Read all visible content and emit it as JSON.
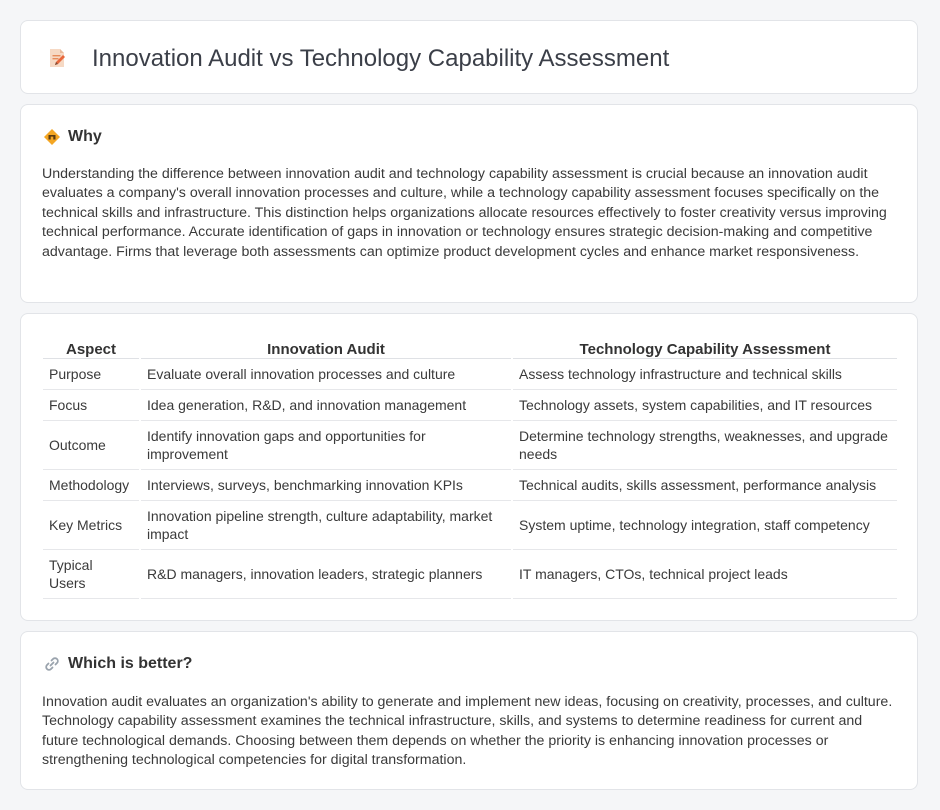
{
  "title": "Innovation Audit vs Technology Capability Assessment",
  "icons": {
    "title": "document-pen-icon",
    "why": "signpost-icon",
    "better": "link-icon"
  },
  "why": {
    "heading": "Why",
    "text": "Understanding the difference between innovation audit and technology capability assessment is crucial because an innovation audit evaluates a company's overall innovation processes and culture, while a technology capability assessment focuses specifically on the technical skills and infrastructure. This distinction helps organizations allocate resources effectively to foster creativity versus improving technical performance. Accurate identification of gaps in innovation or technology ensures strategic decision-making and competitive advantage. Firms that leverage both assessments can optimize product development cycles and enhance market responsiveness."
  },
  "table": {
    "headers": [
      "Aspect",
      "Innovation Audit",
      "Technology Capability Assessment"
    ],
    "rows": [
      [
        "Purpose",
        "Evaluate overall innovation processes and culture",
        "Assess technology infrastructure and technical skills"
      ],
      [
        "Focus",
        "Idea generation, R&D, and innovation management",
        "Technology assets, system capabilities, and IT resources"
      ],
      [
        "Outcome",
        "Identify innovation gaps and opportunities for improvement",
        "Determine technology strengths, weaknesses, and upgrade needs"
      ],
      [
        "Methodology",
        "Interviews, surveys, benchmarking innovation KPIs",
        "Technical audits, skills assessment, performance analysis"
      ],
      [
        "Key Metrics",
        "Innovation pipeline strength, culture adaptability, market impact",
        "System uptime, technology integration, staff competency"
      ],
      [
        "Typical Users",
        "R&D managers, innovation leaders, strategic planners",
        "IT managers, CTOs, technical project leads"
      ]
    ]
  },
  "better": {
    "heading": "Which is better?",
    "text": "Innovation audit evaluates an organization's ability to generate and implement new ideas, focusing on creativity, processes, and culture. Technology capability assessment examines the technical infrastructure, skills, and systems to determine readiness for current and future technological demands. Choosing between them depends on whether the priority is enhancing innovation processes or strengthening technological competencies for digital transformation."
  },
  "colors": {
    "accent": "#f4a623",
    "page_bg": "#f5f6f8",
    "card_border": "#e2e4e8"
  }
}
